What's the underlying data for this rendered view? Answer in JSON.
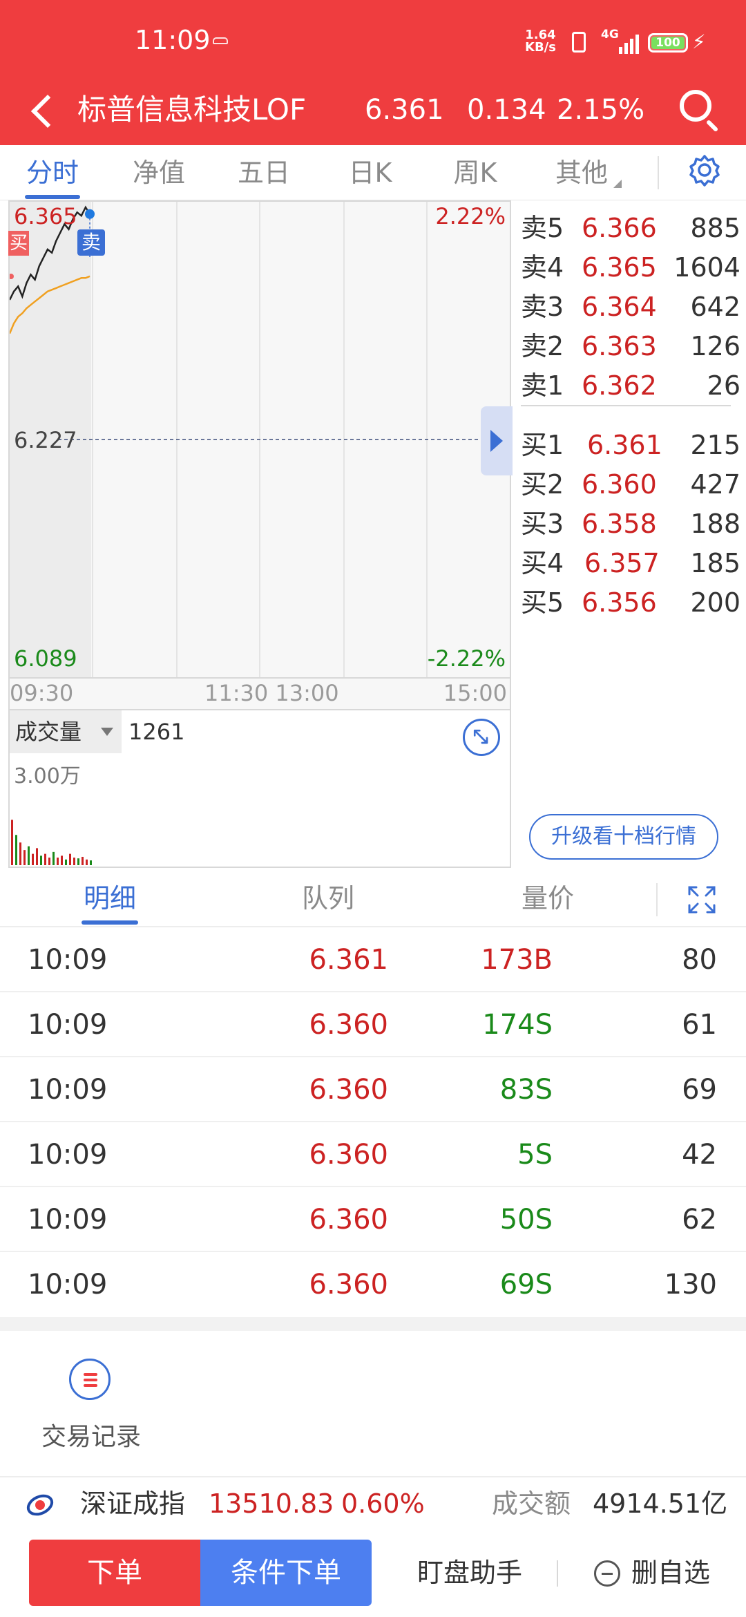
{
  "status_bar": {
    "time": "11:09",
    "net_speed_top": "1.64",
    "net_speed_bottom": "KB/s",
    "signal": "4G",
    "battery": "100"
  },
  "header": {
    "stock_name": "标普信息科技LOF",
    "price": "6.361",
    "change": "0.134",
    "change_pct": "2.15%"
  },
  "chart_tabs": [
    {
      "label": "分时",
      "active": true
    },
    {
      "label": "净值",
      "active": false
    },
    {
      "label": "五日",
      "active": false
    },
    {
      "label": "日K",
      "active": false
    },
    {
      "label": "周K",
      "active": false
    },
    {
      "label": "其他",
      "active": false
    }
  ],
  "chart": {
    "y_high": "6.365",
    "y_mid": "6.227",
    "y_low": "6.089",
    "pct_high": "2.22%",
    "pct_low": "-2.22%",
    "buy_marker": "买",
    "sell_marker": "卖",
    "time_labels": [
      "09:30",
      "11:30 13:00",
      "15:00"
    ],
    "volume_label": "成交量",
    "volume_value": "1261",
    "volume_scale": "3.00万"
  },
  "chart_data": {
    "type": "line",
    "title": "",
    "xlabel": "",
    "ylabel": "",
    "ylim": [
      6.089,
      6.365
    ],
    "reference_price": 6.227,
    "x_ticks": [
      "09:30",
      "11:30 13:00",
      "15:00"
    ],
    "series": [
      {
        "values": [
          6.31,
          6.315,
          6.318,
          6.312,
          6.32,
          6.325,
          6.322,
          6.33,
          6.335,
          6.34,
          6.338,
          6.345,
          6.35,
          6.355,
          6.352,
          6.358,
          6.362,
          6.36,
          6.365,
          6.361
        ],
        "color": "#222222"
      },
      {
        "values": [
          6.29,
          6.296,
          6.3,
          6.302,
          6.305,
          6.307,
          6.309,
          6.311,
          6.313,
          6.315,
          6.316,
          6.317,
          6.318,
          6.319,
          6.32,
          6.321,
          6.322,
          6.323,
          6.323,
          6.324
        ],
        "color": "#f0a020"
      }
    ],
    "volume": {
      "ylim": [
        0,
        30000
      ],
      "values": [
        12000,
        8000,
        6000,
        4000,
        5000,
        3000,
        4500,
        2500,
        3000,
        2000,
        3500,
        2000,
        2500,
        1500,
        3000,
        2000,
        1800,
        2200,
        1500,
        1261
      ]
    }
  },
  "order_book": {
    "asks": [
      {
        "label": "卖5",
        "price": "6.366",
        "volume": "885"
      },
      {
        "label": "卖4",
        "price": "6.365",
        "volume": "1604"
      },
      {
        "label": "卖3",
        "price": "6.364",
        "volume": "642"
      },
      {
        "label": "卖2",
        "price": "6.363",
        "volume": "126"
      },
      {
        "label": "卖1",
        "price": "6.362",
        "volume": "26"
      }
    ],
    "bids": [
      {
        "label": "买1",
        "price": "6.361",
        "volume": "215"
      },
      {
        "label": "买2",
        "price": "6.360",
        "volume": "427"
      },
      {
        "label": "买3",
        "price": "6.358",
        "volume": "188"
      },
      {
        "label": "买4",
        "price": "6.357",
        "volume": "185"
      },
      {
        "label": "买5",
        "price": "6.356",
        "volume": "200"
      }
    ],
    "upgrade_label": "升级看十档行情"
  },
  "detail_tabs": [
    {
      "label": "明细",
      "active": true
    },
    {
      "label": "队列",
      "active": false
    },
    {
      "label": "量价",
      "active": false
    }
  ],
  "trades": [
    {
      "time": "10:09",
      "price": "6.361",
      "volume": "173B",
      "side": "buy",
      "count": "80"
    },
    {
      "time": "10:09",
      "price": "6.360",
      "volume": "174S",
      "side": "sell",
      "count": "61"
    },
    {
      "time": "10:09",
      "price": "6.360",
      "volume": "83S",
      "side": "sell",
      "count": "69"
    },
    {
      "time": "10:09",
      "price": "6.360",
      "volume": "5S",
      "side": "sell",
      "count": "42"
    },
    {
      "time": "10:09",
      "price": "6.360",
      "volume": "50S",
      "side": "sell",
      "count": "62"
    },
    {
      "time": "10:09",
      "price": "6.360",
      "volume": "69S",
      "side": "sell",
      "count": "130"
    }
  ],
  "records": {
    "label": "交易记录"
  },
  "index_bar": {
    "index_name": "深证成指",
    "index_value": "13510.83",
    "index_pct": "0.60%",
    "turnover_label": "成交额",
    "turnover_value": "4914.51亿"
  },
  "actions": {
    "order": "下单",
    "conditional_order": "条件下单",
    "assistant": "盯盘助手",
    "remove_watchlist": "删自选"
  },
  "colors": {
    "brand_red": "#ef3d3f",
    "accent_blue": "#3b6fd4",
    "up_red": "#cc2222",
    "down_green": "#1a8a1a"
  }
}
